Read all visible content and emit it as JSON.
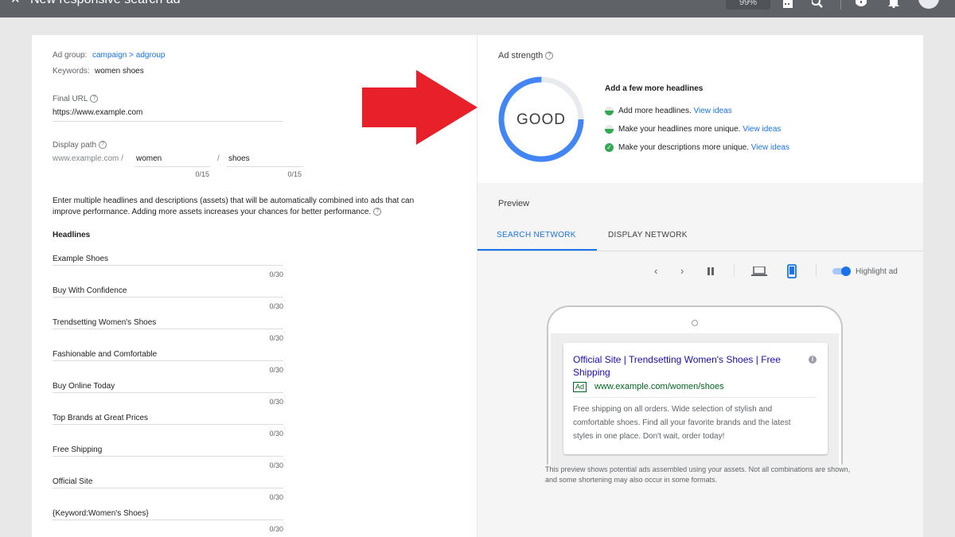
{
  "topbar": {
    "title": "New responsive search ad",
    "box_text": "99%"
  },
  "form": {
    "ad_group_label": "Ad group:",
    "ad_group_value": "campaign > adgroup",
    "keywords_label": "Keywords:",
    "keywords_value": "women shoes",
    "final_url_label": "Final URL",
    "final_url_value": "https://www.example.com",
    "display_path_label": "Display path",
    "display_path_base": "www.example.com /",
    "path1_value": "women",
    "path1_counter": "0/15",
    "path_separator": "/",
    "path2_value": "shoes",
    "path2_counter": "0/15",
    "intro_text": "Enter multiple headlines and descriptions (assets)  that will be automatically combined into ads that can improve performance. Adding more assets increases your chances for better performance.",
    "headlines_title": "Headlines",
    "headlines": [
      {
        "text": "Example Shoes",
        "counter": "0/30"
      },
      {
        "text": "Buy With Confidence",
        "counter": "0/30"
      },
      {
        "text": "Trendsetting Women's Shoes",
        "counter": "0/30"
      },
      {
        "text": "Fashionable and Comfortable",
        "counter": "0/30"
      },
      {
        "text": "Buy Online Today",
        "counter": "0/30"
      },
      {
        "text": "Top Brands at Great Prices",
        "counter": "0/30"
      },
      {
        "text": "Free Shipping",
        "counter": "0/30"
      },
      {
        "text": "Official Site",
        "counter": "0/30"
      },
      {
        "text": "{Keyword:Women's Shoes}",
        "counter": "0/30"
      }
    ]
  },
  "strength": {
    "title": "Ad strength",
    "rating": "GOOD",
    "level": 0.75,
    "gauge_color": "#4285f4",
    "tips_title": "Add a few more headlines",
    "tips": [
      {
        "text": "Add more headlines.",
        "link": "View ideas",
        "status": "half"
      },
      {
        "text": "Make your headlines more unique.",
        "link": "View ideas",
        "status": "half"
      },
      {
        "text": "Make your descriptions more unique.",
        "link": "View ideas",
        "status": "done"
      }
    ]
  },
  "preview": {
    "title": "Preview",
    "tabs": [
      "SEARCH NETWORK",
      "DISPLAY NETWORK"
    ],
    "highlight_label": "Highlight ad",
    "ad": {
      "headline": "Official Site | Trendsetting Women's Shoes | Free Shipping",
      "badge": "Ad",
      "url": "www.example.com/women/shoes",
      "description": "Free shipping on all orders. Wide selection of stylish and comfortable shoes. Find all your favorite brands and the latest styles in one place. Don't wait, order today!"
    },
    "note": "This preview shows potential ads assembled using your assets. Not all combinations are shown, and some shortening may also occur in some formats."
  },
  "colors": {
    "accent": "#1a73e8",
    "arrow": "#e8202a",
    "good": "#34a853"
  },
  "icons": [
    "close-icon",
    "calendar-icon",
    "search-icon",
    "help-icon",
    "bell-icon",
    "avatar",
    "help-circle-icon",
    "chevron-left-icon",
    "chevron-right-icon",
    "pause-icon",
    "laptop-icon",
    "phone-icon",
    "info-icon"
  ]
}
